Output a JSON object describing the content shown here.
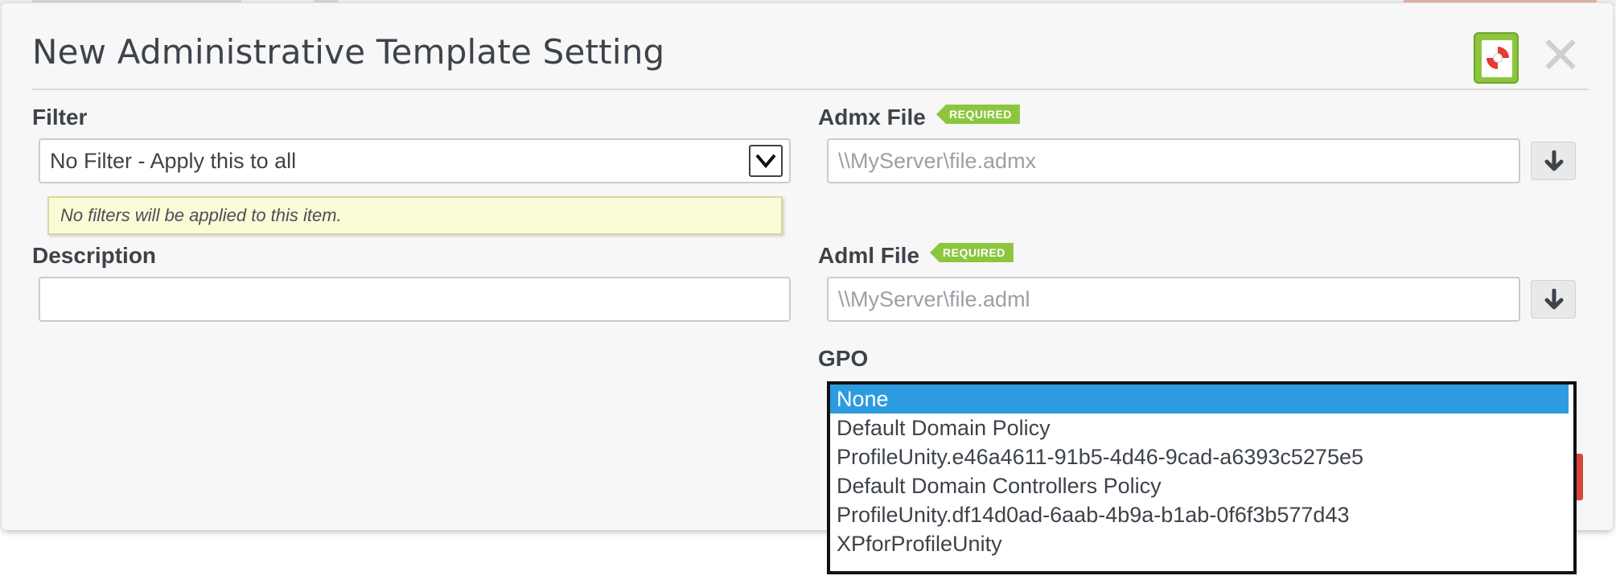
{
  "dialog": {
    "title": "New Administrative Template Setting",
    "help_icon": "life-ring-help-icon",
    "close_icon": "close-x-icon"
  },
  "filter": {
    "label": "Filter",
    "selected": "No Filter - Apply this to all",
    "hint": "No filters will be applied to this item."
  },
  "description": {
    "label": "Description",
    "value": ""
  },
  "admx": {
    "label": "Admx File",
    "badge": "REQUIRED",
    "placeholder": "\\\\MyServer\\file.admx"
  },
  "adml": {
    "label": "Adml File",
    "badge": "REQUIRED",
    "placeholder": "\\\\MyServer\\file.adml"
  },
  "gpo": {
    "label": "GPO",
    "options": [
      "None",
      "Default Domain Policy",
      "ProfileUnity.e46a4611-91b5-4d46-9cad-a6393c5275e5",
      "Default Domain Controllers Policy",
      "ProfileUnity.df14d0ad-6aab-4b9a-b1ab-0f6f3b577d43",
      "XPforProfileUnity"
    ],
    "selected_index": 0
  },
  "colors": {
    "accent_green": "#8cc63f",
    "selection_blue": "#2d9be0",
    "danger_red": "#d9453b"
  }
}
